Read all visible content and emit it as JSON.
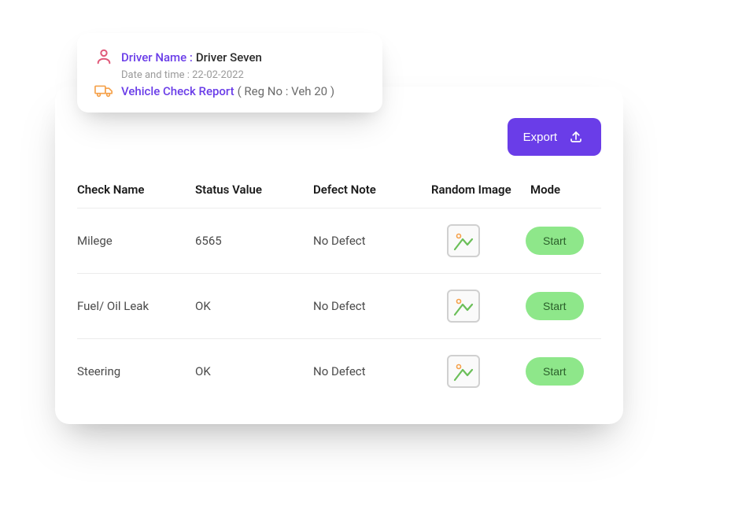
{
  "info": {
    "driver_label": "Driver Name :",
    "driver_name": "Driver Seven",
    "datetime_label": "Date and time :",
    "datetime_value": "22-02-2022",
    "report_label": "Vehicle Check Report",
    "reg_label": "( Reg No : Veh 20 )"
  },
  "export_label": "Export",
  "table": {
    "headers": {
      "check": "Check Name",
      "status": "Status Value",
      "defect": "Defect Note",
      "image": "Random Image",
      "mode": "Mode"
    },
    "rows": [
      {
        "check": "Milege",
        "status": "6565",
        "defect": "No Defect",
        "mode": "Start"
      },
      {
        "check": "Fuel/ Oil Leak",
        "status": "OK",
        "defect": "No Defect",
        "mode": "Start"
      },
      {
        "check": "Steering",
        "status": "OK",
        "defect": "No Defect",
        "mode": "Start"
      }
    ]
  },
  "colors": {
    "accent": "#6a3de8",
    "start_bg": "#8ee78a",
    "person_icon": "#e05a7a",
    "truck_icon": "#f5a14a"
  }
}
